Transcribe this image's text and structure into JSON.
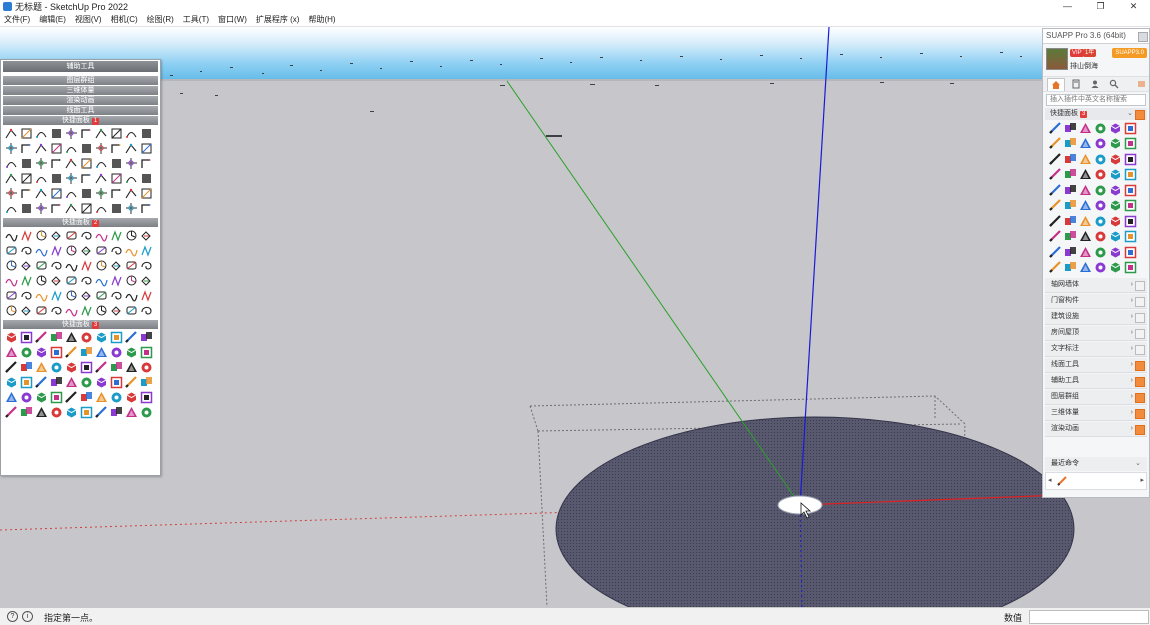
{
  "window": {
    "title": "无标题 - SketchUp Pro 2022",
    "controls": [
      "—",
      "❐",
      "✕"
    ]
  },
  "menu": [
    "文件(F)",
    "编辑(E)",
    "视图(V)",
    "相机(C)",
    "绘图(R)",
    "工具(T)",
    "窗口(W)",
    "扩展程序 (x)",
    "帮助(H)"
  ],
  "left_panel": {
    "header": "辅助工具",
    "sections": [
      "图层群组",
      "三维体量",
      "渲染动画",
      "线面工具"
    ],
    "quick_panels": [
      {
        "label": "快捷面板",
        "badge": "1"
      },
      {
        "label": "快捷面板",
        "badge": "2"
      },
      {
        "label": "快捷面板",
        "badge": "3"
      }
    ]
  },
  "right_panel": {
    "title": "SUAPP Pro 3.6 (64bit)",
    "user": {
      "vip": "VIP",
      "vip_level": "1年",
      "name": "排山倒海",
      "version_badge": "SUAPP3.0"
    },
    "tabs": [
      "home-icon",
      "book-icon",
      "user-icon",
      "search-icon"
    ],
    "search_placeholder": "插入插件中英文名称搜索",
    "quick_panel": {
      "label": "快捷面板",
      "badge": "3"
    },
    "categories": [
      {
        "label": "轴网墙体",
        "orange": false
      },
      {
        "label": "门窗构件",
        "orange": false
      },
      {
        "label": "建筑设施",
        "orange": false
      },
      {
        "label": "房间屋顶",
        "orange": false
      },
      {
        "label": "文字标注",
        "orange": false
      },
      {
        "label": "线面工具",
        "orange": true
      },
      {
        "label": "辅助工具",
        "orange": true
      },
      {
        "label": "图层群组",
        "orange": true
      },
      {
        "label": "三维体量",
        "orange": true
      },
      {
        "label": "渲染动画",
        "orange": true
      }
    ],
    "recent_label": "最近命令",
    "recent_prev": "◂",
    "recent_next": "▸"
  },
  "status": {
    "icon1": "?",
    "icon2": "i",
    "text": "指定第一点。",
    "value_label": "数值",
    "value": ""
  },
  "colors": {
    "axis_red": "#e02020",
    "axis_green": "#2aa02a",
    "axis_blue": "#1a1ad8",
    "ground": "#c6c6ca",
    "ellipse": "#55566e",
    "accent_orange": "#f28b3c"
  }
}
